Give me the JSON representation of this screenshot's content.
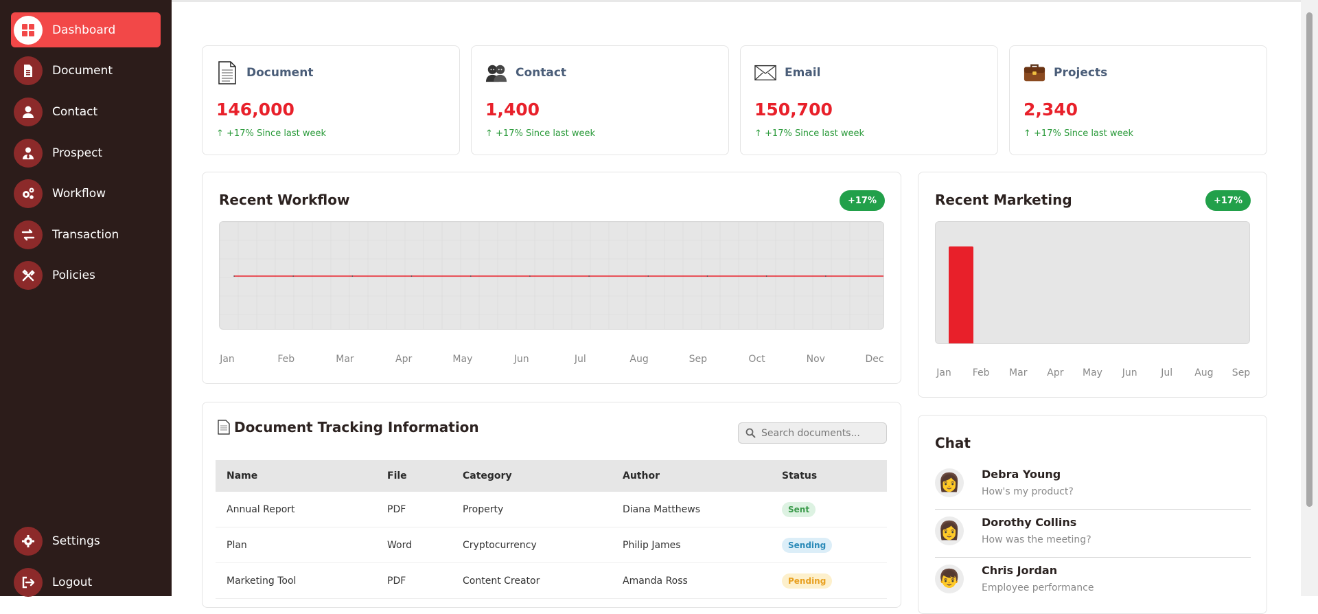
{
  "sidebar": {
    "items": [
      {
        "label": "Dashboard",
        "icon": "grid-icon"
      },
      {
        "label": "Document",
        "icon": "document-icon"
      },
      {
        "label": "Contact",
        "icon": "user-icon"
      },
      {
        "label": "Prospect",
        "icon": "user-tie-icon"
      },
      {
        "label": "Workflow",
        "icon": "gears-icon"
      },
      {
        "label": "Transaction",
        "icon": "exchange-icon"
      },
      {
        "label": "Policies",
        "icon": "tools-icon"
      }
    ],
    "settings": {
      "label": "Settings",
      "icon": "gear-icon"
    },
    "logout": {
      "label": "Logout",
      "icon": "logout-icon"
    }
  },
  "stats": [
    {
      "title": "Document",
      "value": "146,000",
      "trend": "↑ +17% Since last week",
      "icon": "document-icon"
    },
    {
      "title": "Contact",
      "value": "1,400",
      "trend": "↑ +17% Since last week",
      "icon": "people-icon"
    },
    {
      "title": "Email",
      "value": "150,700",
      "trend": "↑ +17% Since last week",
      "icon": "envelope-icon"
    },
    {
      "title": "Projects",
      "value": "2,340",
      "trend": "↑ +17% Since last week",
      "icon": "briefcase-icon"
    }
  ],
  "workflow": {
    "title": "Recent Workflow",
    "badge": "+17%"
  },
  "marketing": {
    "title": "Recent Marketing",
    "badge": "+17%"
  },
  "chart_data": [
    {
      "type": "line",
      "title": "Recent Workflow",
      "categories": [
        "Jan",
        "Feb",
        "Mar",
        "Apr",
        "May",
        "Jun",
        "Jul",
        "Aug",
        "Sep",
        "Oct",
        "Nov",
        "Dec"
      ],
      "values": [
        0,
        0,
        0,
        0,
        0,
        0,
        0,
        0,
        0,
        0,
        0,
        0
      ],
      "grid": true,
      "color": "#e8202a"
    },
    {
      "type": "bar",
      "title": "Recent Marketing",
      "categories": [
        "Jan",
        "Feb",
        "Mar",
        "Apr",
        "May",
        "Jun",
        "Jul",
        "Aug",
        "Sep"
      ],
      "values": [
        1,
        0,
        0,
        0,
        0,
        0,
        0,
        0,
        0
      ],
      "ylim": [
        0,
        1.25
      ],
      "color": "#e8202a"
    }
  ],
  "documents": {
    "title": "Document Tracking Information",
    "search_placeholder": "Search documents...",
    "columns": [
      "Name",
      "File",
      "Category",
      "Author",
      "Status"
    ],
    "rows": [
      {
        "name": "Annual Report",
        "file": "PDF",
        "category": "Property",
        "author": "Diana Matthews",
        "status": "Sent"
      },
      {
        "name": "Plan",
        "file": "Word",
        "category": "Cryptocurrency",
        "author": "Philip James",
        "status": "Sending"
      },
      {
        "name": "Marketing Tool",
        "file": "PDF",
        "category": "Content Creator",
        "author": "Amanda Ross",
        "status": "Pending"
      }
    ]
  },
  "chat": {
    "title": "Chat",
    "items": [
      {
        "name": "Debra Young",
        "message": "How's my product?",
        "avatar": "👩"
      },
      {
        "name": "Dorothy Collins",
        "message": "How was the meeting?",
        "avatar": "👩"
      },
      {
        "name": "Chris Jordan",
        "message": "Employee performance",
        "avatar": "👦"
      }
    ]
  },
  "colors": {
    "accent": "#f24848",
    "value_red": "#e8202a",
    "trend_green": "#2a9a3a",
    "sidebar_bg": "#2c1c1a",
    "status_sent": "#3a9a4a",
    "status_sending": "#2a8ab8",
    "status_pending": "#e8a020"
  }
}
